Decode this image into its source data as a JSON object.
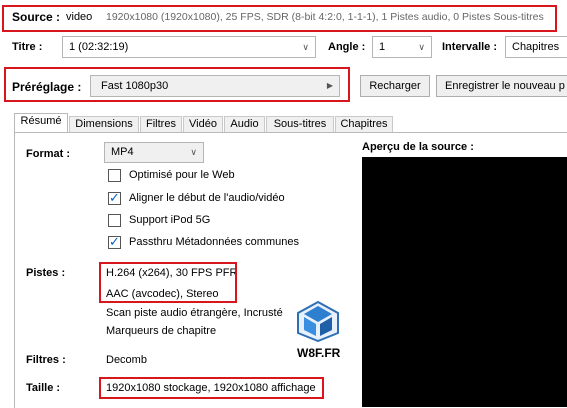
{
  "source_bar": {
    "label": "Source :",
    "name": "video",
    "details": "1920x1080 (1920x1080), 25 FPS, SDR (8-bit 4:2:0, 1-1-1), 1 Pistes audio, 0 Pistes Sous-titres"
  },
  "title_row": {
    "titre_label": "Titre :",
    "titre_value": "1  (02:32:19)",
    "angle_label": "Angle :",
    "angle_value": "1",
    "intervalle_label": "Intervalle :",
    "intervalle_value": "Chapitres"
  },
  "preset_row": {
    "label": "Préréglage :",
    "value": "Fast 1080p30",
    "reload_button": "Recharger",
    "save_button": "Enregistrer le nouveau p"
  },
  "tabs": [
    "Résumé",
    "Dimensions",
    "Filtres",
    "Vidéo",
    "Audio",
    "Sous-titres",
    "Chapitres"
  ],
  "summary": {
    "format_label": "Format :",
    "format_value": "MP4",
    "options": [
      {
        "label": "Optimisé pour le Web",
        "checked": false
      },
      {
        "label": "Aligner le début de l'audio/vidéo",
        "checked": true
      },
      {
        "label": "Support iPod 5G",
        "checked": false
      },
      {
        "label": "Passthru Métadonnées communes",
        "checked": true
      }
    ],
    "pistes_label": "Pistes :",
    "pistes_lines": [
      "H.264 (x264), 30 FPS PFR",
      "AAC (avcodec), Stereo",
      "Scan piste audio étrangère, Incrusté",
      "Marqueurs de chapitre"
    ],
    "filtres_label": "Filtres :",
    "filtres_value": "Decomb",
    "taille_label": "Taille :",
    "taille_value": "1920x1080 stockage, 1920x1080 affichage"
  },
  "preview": {
    "label": "Aperçu de la source :"
  },
  "watermark": {
    "text": "W8F.FR"
  },
  "colors": {
    "highlight_box": "#d8161d",
    "checkbox_tick": "#0a5fbf",
    "preview_bg": "#000000"
  }
}
